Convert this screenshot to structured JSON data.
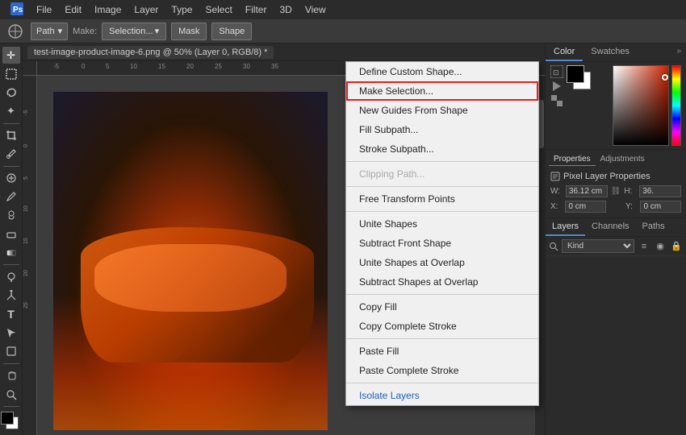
{
  "app": {
    "title": "Adobe Photoshop"
  },
  "menubar": {
    "items": [
      "PS",
      "File",
      "Edit",
      "Image",
      "Layer",
      "Type",
      "Select",
      "Filter",
      "3D",
      "View"
    ]
  },
  "optionsbar": {
    "tool_icon": "⊙",
    "path_label": "Path",
    "make_label": "Make:",
    "selection_label": "Selection...",
    "mask_label": "Mask",
    "shape_label": "Shape"
  },
  "tab": {
    "label": "test-image-product-image-6.png @ 50% (Layer 0, RGB/8) *"
  },
  "context_menu": {
    "items": [
      {
        "id": "define-custom-shape",
        "label": "Define Custom Shape...",
        "enabled": true,
        "highlighted": false,
        "blue": false
      },
      {
        "id": "make-selection",
        "label": "Make Selection...",
        "enabled": true,
        "highlighted": true,
        "blue": false
      },
      {
        "id": "new-guides",
        "label": "New Guides From Shape",
        "enabled": true,
        "highlighted": false,
        "blue": false
      },
      {
        "id": "fill-subpath",
        "label": "Fill Subpath...",
        "enabled": true,
        "highlighted": false,
        "blue": false
      },
      {
        "id": "stroke-subpath",
        "label": "Stroke Subpath...",
        "enabled": true,
        "highlighted": false,
        "blue": false
      },
      {
        "id": "sep1",
        "type": "separator"
      },
      {
        "id": "clipping-path",
        "label": "Clipping Path...",
        "enabled": false,
        "highlighted": false,
        "blue": false
      },
      {
        "id": "sep2",
        "type": "separator"
      },
      {
        "id": "free-transform",
        "label": "Free Transform Points",
        "enabled": true,
        "highlighted": false,
        "blue": false
      },
      {
        "id": "sep3",
        "type": "separator"
      },
      {
        "id": "unite-shapes",
        "label": "Unite Shapes",
        "enabled": true,
        "highlighted": false,
        "blue": false
      },
      {
        "id": "subtract-front",
        "label": "Subtract Front Shape",
        "enabled": true,
        "highlighted": false,
        "blue": false
      },
      {
        "id": "unite-overlap",
        "label": "Unite Shapes at Overlap",
        "enabled": true,
        "highlighted": false,
        "blue": false
      },
      {
        "id": "subtract-overlap",
        "label": "Subtract Shapes at Overlap",
        "enabled": true,
        "highlighted": false,
        "blue": false
      },
      {
        "id": "sep4",
        "type": "separator"
      },
      {
        "id": "copy-fill",
        "label": "Copy Fill",
        "enabled": true,
        "highlighted": false,
        "blue": false
      },
      {
        "id": "copy-complete-stroke",
        "label": "Copy Complete Stroke",
        "enabled": true,
        "highlighted": false,
        "blue": false
      },
      {
        "id": "sep5",
        "type": "separator"
      },
      {
        "id": "paste-fill",
        "label": "Paste Fill",
        "enabled": true,
        "highlighted": false,
        "blue": false
      },
      {
        "id": "paste-complete-stroke",
        "label": "Paste Complete Stroke",
        "enabled": true,
        "highlighted": false,
        "blue": false
      },
      {
        "id": "sep6",
        "type": "separator"
      },
      {
        "id": "isolate-layers",
        "label": "Isolate Layers",
        "enabled": true,
        "highlighted": false,
        "blue": true
      }
    ]
  },
  "color_panel": {
    "tab1": "Color",
    "tab2": "Swatches"
  },
  "properties_panel": {
    "tab1": "Properties",
    "tab2": "Adjustments",
    "section_title": "Pixel Layer Properties",
    "w_label": "W:",
    "w_value": "36.12 cm",
    "h_label": "H:",
    "h_value": "36.",
    "x_label": "X:",
    "x_value": "0 cm",
    "y_label": "Y:",
    "y_value": "0 cm"
  },
  "layers_panel": {
    "tab1": "Layers",
    "tab2": "Channels",
    "tab3": "Paths",
    "filter_label": "Kind",
    "search_placeholder": "Kind"
  },
  "tools": [
    {
      "id": "move",
      "icon": "✛"
    },
    {
      "id": "select-rect",
      "icon": "⬜"
    },
    {
      "id": "lasso",
      "icon": "⌇"
    },
    {
      "id": "magic-wand",
      "icon": "✦"
    },
    {
      "id": "crop",
      "icon": "⊡"
    },
    {
      "id": "eyedropper",
      "icon": "✏"
    },
    {
      "id": "healing",
      "icon": "⊕"
    },
    {
      "id": "brush",
      "icon": "⬤"
    },
    {
      "id": "clone",
      "icon": "◈"
    },
    {
      "id": "eraser",
      "icon": "▭"
    },
    {
      "id": "gradient",
      "icon": "▬"
    },
    {
      "id": "dodge",
      "icon": "◯"
    },
    {
      "id": "pen",
      "icon": "⊘"
    },
    {
      "id": "text",
      "icon": "T"
    },
    {
      "id": "path-select",
      "icon": "↗"
    },
    {
      "id": "shape",
      "icon": "▣"
    },
    {
      "id": "hand",
      "icon": "✋"
    },
    {
      "id": "zoom",
      "icon": "⊕"
    }
  ]
}
